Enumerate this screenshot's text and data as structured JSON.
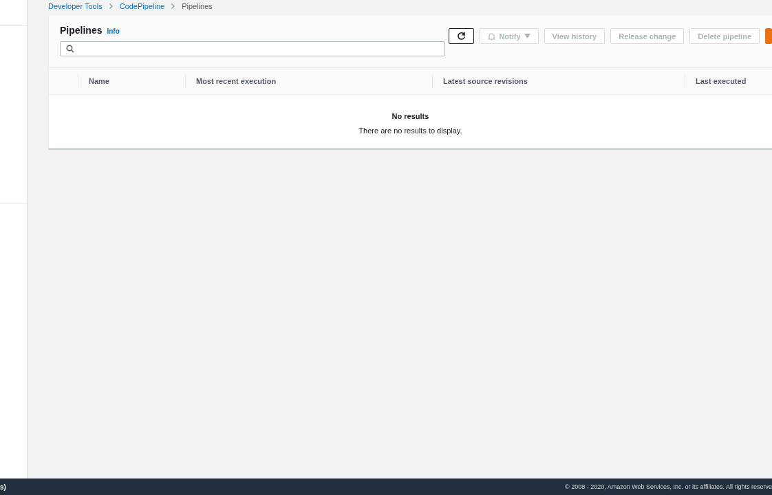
{
  "breadcrumbs": [
    {
      "label": "Developer Tools",
      "link": true
    },
    {
      "label": "CodePipeline",
      "link": true
    },
    {
      "label": "Pipelines",
      "link": false
    }
  ],
  "panel": {
    "title": "Pipelines",
    "info": "Info"
  },
  "actions": [
    {
      "kind": "refresh",
      "disabled": false
    },
    {
      "kind": "notify",
      "label": "Notify",
      "disabled": true
    },
    {
      "kind": "plain",
      "label": "View history",
      "disabled": true
    },
    {
      "kind": "plain",
      "label": "Release change",
      "disabled": true
    },
    {
      "kind": "plain",
      "label": "Delete pipeline",
      "disabled": true
    },
    {
      "kind": "primary",
      "disabled": false
    }
  ],
  "table": {
    "columns": [
      "Name",
      "Most recent execution",
      "Latest source revisions",
      "Last executed"
    ],
    "empty_title": "No results",
    "empty_text": "There are no results to display."
  },
  "footer": {
    "left": "s)",
    "copyright": "© 2008 - 2020, Amazon Web Services, Inc. or its affiliates. All rights reserve"
  }
}
